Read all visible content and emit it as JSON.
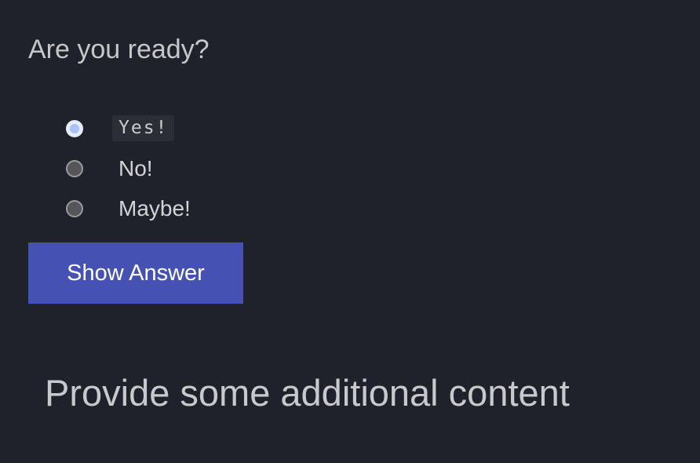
{
  "question": {
    "title": "Are you ready?"
  },
  "options": [
    {
      "label": "Yes!",
      "selected": true,
      "style": "code"
    },
    {
      "label": "No!",
      "selected": false,
      "style": "plain"
    },
    {
      "label": "Maybe!",
      "selected": false,
      "style": "plain"
    }
  ],
  "actions": {
    "show_answer_label": "Show Answer"
  },
  "content": {
    "additional_text": "Provide some additional content"
  },
  "colors": {
    "background": "#20222b",
    "button": "#4652b3",
    "radio_selected": "#a9c2f6"
  }
}
